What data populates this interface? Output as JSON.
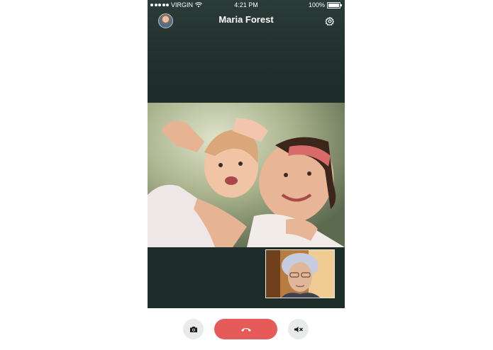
{
  "status_bar": {
    "carrier": "VIRGIN",
    "time": "4:21 PM",
    "battery": "100%"
  },
  "call": {
    "contact_name": "Maria Forest"
  },
  "icons": {
    "settings": "gear-icon",
    "camera": "camera-icon",
    "end_call": "phone-hangup-icon",
    "mute": "speaker-mute-icon"
  },
  "colors": {
    "background": "#1f2d2a",
    "end_call": "#e65a5a",
    "control_button": "#e9ebea"
  }
}
